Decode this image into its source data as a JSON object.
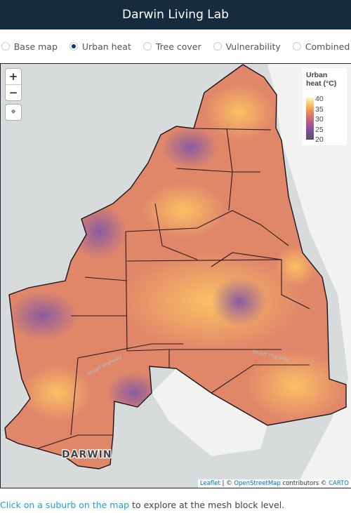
{
  "header": {
    "title": "Darwin Living Lab"
  },
  "layers": [
    {
      "label": "Base map",
      "selected": false
    },
    {
      "label": "Urban heat",
      "selected": true
    },
    {
      "label": "Tree cover",
      "selected": false
    },
    {
      "label": "Vulnerability",
      "selected": false
    },
    {
      "label": "Combined",
      "selected": false
    }
  ],
  "map": {
    "zoom_in": "+",
    "zoom_out": "−",
    "locate_icon": "crosshair-icon",
    "city_label": "DARWIN",
    "road_labels": [
      "Stuart Highway",
      "Stuart Highway"
    ],
    "legend": {
      "title": "Urban heat (°C)",
      "ticks": [
        "40",
        "35",
        "30",
        "25",
        "20"
      ],
      "colors": [
        "#fdf7c0",
        "#fcb55a",
        "#e17a64",
        "#b25a87",
        "#7a4f9a",
        "#5b5060"
      ]
    },
    "attribution": {
      "leaflet": "Leaflet",
      "sep": " | © ",
      "osm": "OpenStreetMap",
      "rest": " contributors © ",
      "carto": "CARTO"
    }
  },
  "footer": {
    "link": "Click on a suburb on the map",
    "rest": " to explore at the mesh block level."
  }
}
